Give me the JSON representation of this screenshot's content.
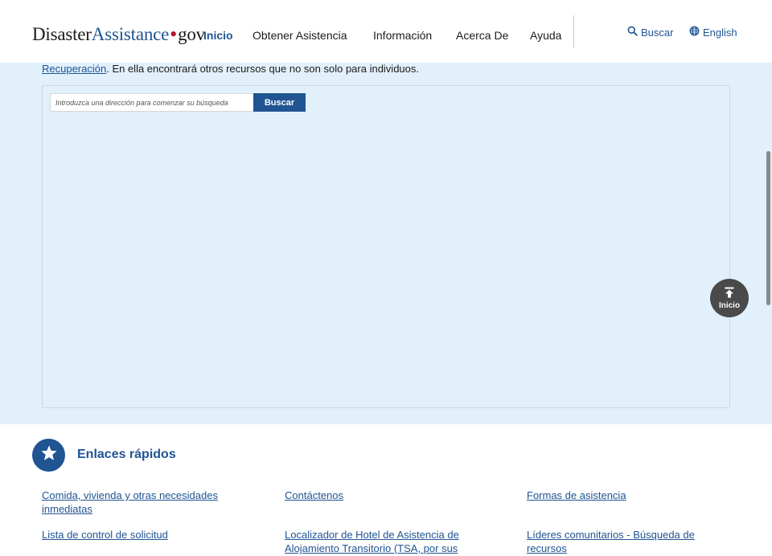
{
  "header": {
    "logo": {
      "part1": "Disaster",
      "part2": "Assistance",
      "dot": "•",
      "part3": "gov"
    },
    "nav": [
      {
        "label": "Inicio",
        "active": true
      },
      {
        "label": "Obtener Asistencia",
        "active": false
      },
      {
        "label": "Información",
        "active": false
      },
      {
        "label": "Acerca De",
        "active": false
      },
      {
        "label": "Ayuda",
        "active": false
      }
    ],
    "search_label": "Buscar",
    "language_label": "English"
  },
  "map_section": {
    "intro_link": "Recuperación",
    "intro_text": ". En ella encontrará otros recursos que no son solo para individuos.",
    "search_placeholder": "Introduzca una dirección para comenzar su búsqueda",
    "search_button": "Buscar"
  },
  "back_to_top": {
    "label": "Inicio",
    "icon": "arrow-up-to-line-icon"
  },
  "quick_links": {
    "title": "Enlaces rápidos",
    "icon": "star-icon",
    "links": [
      "Comida, vivienda y otras necesidades inmediatas",
      "Contáctenos",
      "Formas de asistencia",
      "Lista de control de solicitud",
      "Localizador de Hotel de Asistencia de Alojamiento Transitorio (TSA, por sus",
      "Líderes comunitarios - Búsqueda de recursos"
    ]
  },
  "colors": {
    "brand_blue": "#205493",
    "logo_red": "#b5132f",
    "map_background": "#e1f0fa",
    "back_to_top_bg": "#4a4a4a"
  }
}
